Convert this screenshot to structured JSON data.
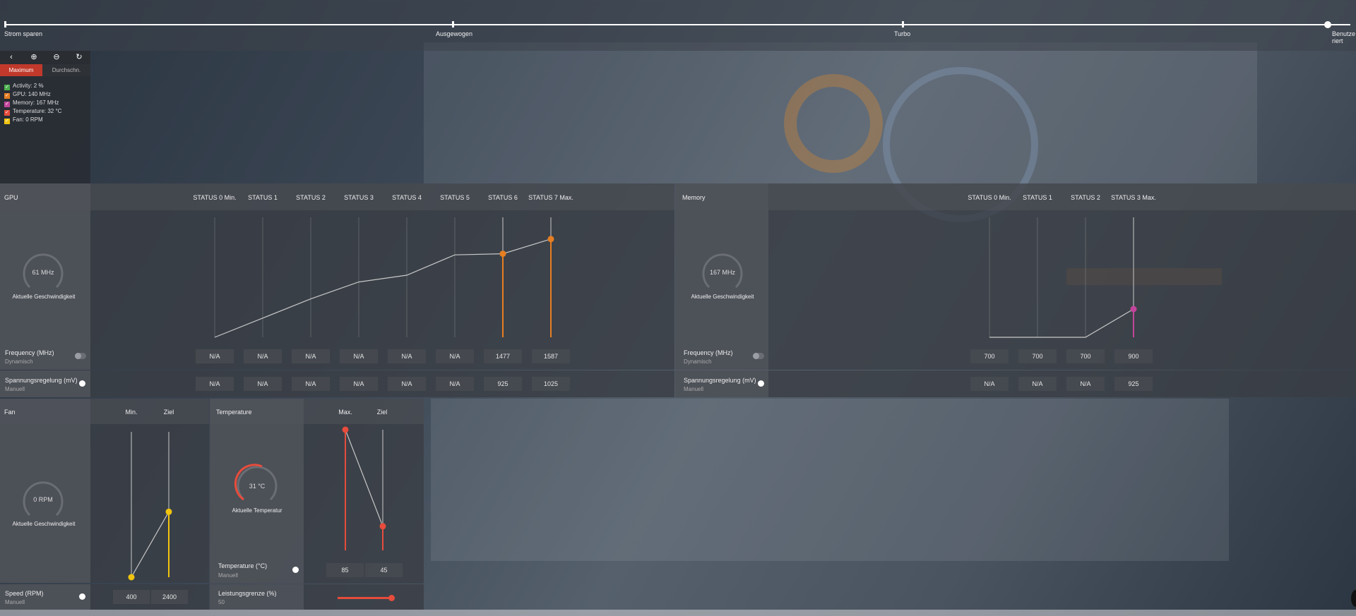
{
  "profile_slider": {
    "stops": [
      "Strom sparen",
      "Ausgewogen",
      "Turbo",
      "Benutzer­iert"
    ],
    "selected": "Benutzeriert"
  },
  "toolbar": {
    "back_icon": "chevron-left-icon",
    "zoom_in_icon": "zoom-in-icon",
    "zoom_out_icon": "zoom-out-icon",
    "reset_icon": "reset-zoom-icon"
  },
  "tabs": {
    "maximum": "Maximum",
    "average": "Durchschn."
  },
  "legend": [
    {
      "label": "Activity: 2 %",
      "color": "#4caf50"
    },
    {
      "label": "GPU: 140 MHz",
      "color": "#e67e22"
    },
    {
      "label": "Memory: 167 MHz",
      "color": "#c2459b"
    },
    {
      "label": "Temperature: 32 °C",
      "color": "#e74c3c"
    },
    {
      "label": "Fan: 0 RPM",
      "color": "#f1c40f"
    }
  ],
  "gpu": {
    "title": "GPU",
    "columns": [
      "STATUS 0 Min.",
      "STATUS 1",
      "STATUS 2",
      "STATUS 3",
      "STATUS 4",
      "STATUS 5",
      "STATUS 6",
      "STATUS 7 Max."
    ],
    "gauge_value": "61 MHz",
    "gauge_label": "Aktuelle Geschwindigkeit",
    "frequency_label": "Frequency (MHz)",
    "frequency_mode": "Dynamisch",
    "frequency_values": [
      "N/A",
      "N/A",
      "N/A",
      "N/A",
      "N/A",
      "N/A",
      "1477",
      "1587"
    ],
    "voltage_label": "Spannungsregelung (mV)",
    "voltage_mode": "Manuell",
    "voltage_values": [
      "N/A",
      "N/A",
      "N/A",
      "N/A",
      "N/A",
      "N/A",
      "925",
      "1025"
    ],
    "curve": [
      0,
      0.17,
      0.34,
      0.49,
      0.55,
      0.73,
      0.74,
      0.87
    ],
    "accent": "#e67e22"
  },
  "memory": {
    "title": "Memory",
    "columns": [
      "STATUS 0 Min.",
      "STATUS 1",
      "STATUS 2",
      "STATUS 3 Max."
    ],
    "gauge_value": "167 MHz",
    "gauge_label": "Aktuelle Geschwindigkeit",
    "frequency_label": "Frequency (MHz)",
    "frequency_mode": "Dynamisch",
    "frequency_values": [
      "700",
      "700",
      "700",
      "900"
    ],
    "voltage_label": "Spannungsregelung (mV)",
    "voltage_mode": "Manuell",
    "voltage_values": [
      "N/A",
      "N/A",
      "N/A",
      "925"
    ],
    "curve": [
      0,
      0,
      0,
      0.25
    ],
    "accent": "#c2459b"
  },
  "fan": {
    "title": "Fan",
    "columns": [
      "Min.",
      "Ziel"
    ],
    "gauge_value": "0 RPM",
    "gauge_label": "Aktuelle Geschwindigkeit",
    "speed_label": "Speed (RPM)",
    "speed_mode": "Manuell",
    "speed_values": [
      "400",
      "2400"
    ],
    "levels": [
      0,
      0.45
    ],
    "accent": "#f1c40f"
  },
  "temperature": {
    "title": "Temperature",
    "columns": [
      "Max.",
      "Ziel"
    ],
    "gauge_value": "31 °C",
    "gauge_label": "Aktuelle Temperatur",
    "temp_label": "Temperature (°C)",
    "temp_mode": "Manuell",
    "temp_values": [
      "85",
      "45"
    ],
    "levels": [
      1,
      0.2
    ],
    "power_label": "Leistungsgrenze (%)",
    "power_value": "50",
    "power_level": 0.95,
    "accent": "#e74c3c"
  }
}
